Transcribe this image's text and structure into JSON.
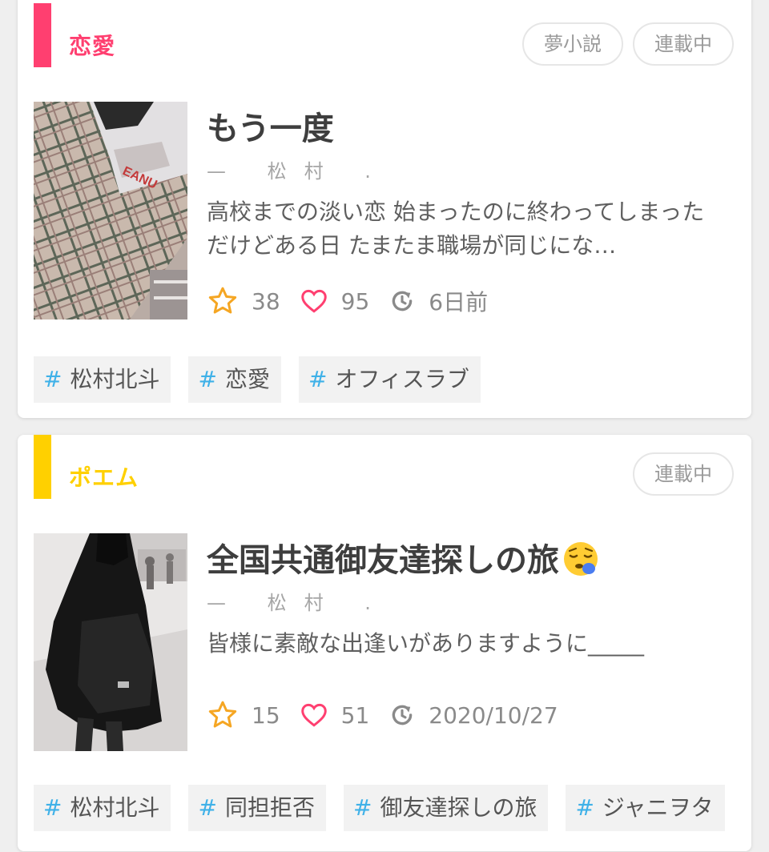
{
  "stories": [
    {
      "genre": "恋愛",
      "genre_color": "#ff3f70",
      "badges": [
        "夢小説",
        "連載中"
      ],
      "title": "もう一度",
      "author": "— 松村 .",
      "description": "高校までの淡い恋 始まったのに終わってしまった だけどある日 たまたま職場が同じにな…",
      "stars": "38",
      "likes": "95",
      "updated": "6日前",
      "tags": [
        "松村北斗",
        "恋愛",
        "オフィスラブ"
      ]
    },
    {
      "genre": "ポエム",
      "genre_color": "#ffd000",
      "badges": [
        "連載中"
      ],
      "title": "全国共通御友達探しの旅",
      "title_emoji": "sleepy-face-emoji",
      "author": "— 松村 .",
      "description": "皆様に素敵な出逢いがありますように_____",
      "stars": "15",
      "likes": "51",
      "updated": "2020/10/27",
      "tags": [
        "松村北斗",
        "同担拒否",
        "御友達探しの旅",
        "ジャニヲタ"
      ]
    }
  ],
  "icons": {
    "star": "star-icon",
    "heart": "heart-icon",
    "updated": "refresh-clock-icon",
    "tag_prefix": "#"
  },
  "colors": {
    "star": "#f5a623",
    "heart": "#ff3f70",
    "hash": "#3fb1e8"
  }
}
